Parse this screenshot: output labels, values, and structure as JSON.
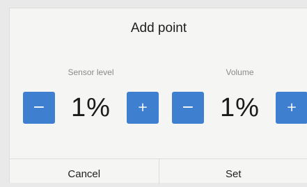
{
  "dialog": {
    "title": "Add point",
    "sensor": {
      "label": "Sensor level",
      "value": "1%",
      "minus_icon": "minus-icon",
      "plus_icon": "plus-icon",
      "minus_glyph": "−",
      "plus_glyph": "+"
    },
    "volume": {
      "label": "Volume",
      "value": "1%",
      "minus_icon": "minus-icon",
      "plus_icon": "plus-icon",
      "minus_glyph": "−",
      "plus_glyph": "+"
    },
    "cancel_label": "Cancel",
    "set_label": "Set"
  },
  "colors": {
    "accent": "#3f7fd0",
    "background": "#f5f5f3",
    "label_text": "#8a8a8a"
  }
}
